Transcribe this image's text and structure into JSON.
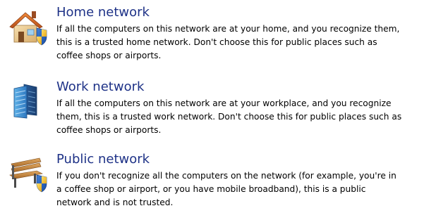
{
  "network_options": [
    {
      "icon": "house-with-shield-icon",
      "title": "Home network",
      "description": "If all the computers on this network are at your home, and you recognize them,\nthis is a trusted home network.  Don't choose this for public places such as\ncoffee shops or airports."
    },
    {
      "icon": "office-building-icon",
      "title": "Work network",
      "description": "If all the computers on this network are at your workplace, and you recognize\nthem, this is a trusted work network.  Don't choose this for public places such as\ncoffee shops or airports."
    },
    {
      "icon": "park-bench-with-shield-icon",
      "title": "Public network",
      "description": "If you don't recognize all the computers on the network (for example, you're in\na coffee shop or airport, or you have mobile broadband), this is a public\nnetwork and is not trusted."
    }
  ],
  "colors": {
    "title": "#1e3287",
    "description": "#000000",
    "background": "#ffffff"
  }
}
